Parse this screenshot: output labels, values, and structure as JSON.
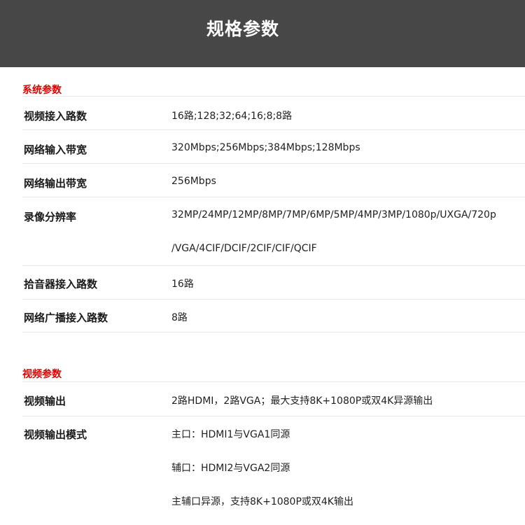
{
  "header": {
    "title": "规格参数"
  },
  "sections": [
    {
      "title": "系统参数",
      "rows": [
        {
          "label": "视频接入路数",
          "values": [
            "16路;128;32;64;16;8;8路"
          ]
        },
        {
          "label": "网络输入带宽",
          "values": [
            "320Mbps;256Mbps;384Mbps;128Mbps"
          ]
        },
        {
          "label": "网络输出带宽",
          "values": [
            "256Mbps"
          ]
        },
        {
          "label": "录像分辨率",
          "values": [
            "32MP/24MP/12MP/8MP/7MP/6MP/5MP/4MP/3MP/1080p/UXGA/720p",
            "/VGA/4CIF/DCIF/2CIF/CIF/QCIF"
          ]
        },
        {
          "label": "拾音器接入路数",
          "values": [
            "16路"
          ]
        },
        {
          "label": "网络广播接入路数",
          "values": [
            "8路"
          ]
        }
      ]
    },
    {
      "title": "视频参数",
      "rows": [
        {
          "label": "视频输出",
          "values": [
            "2路HDMI，2路VGA；最大支持8K+1080P或双4K异源输出"
          ]
        },
        {
          "label": "视频输出模式",
          "values": [
            "主口：HDMI1与VGA1同源",
            "辅口：HDMI2与VGA2同源",
            "主辅口异源，支持8K+1080P或双4K输出"
          ]
        }
      ]
    }
  ]
}
